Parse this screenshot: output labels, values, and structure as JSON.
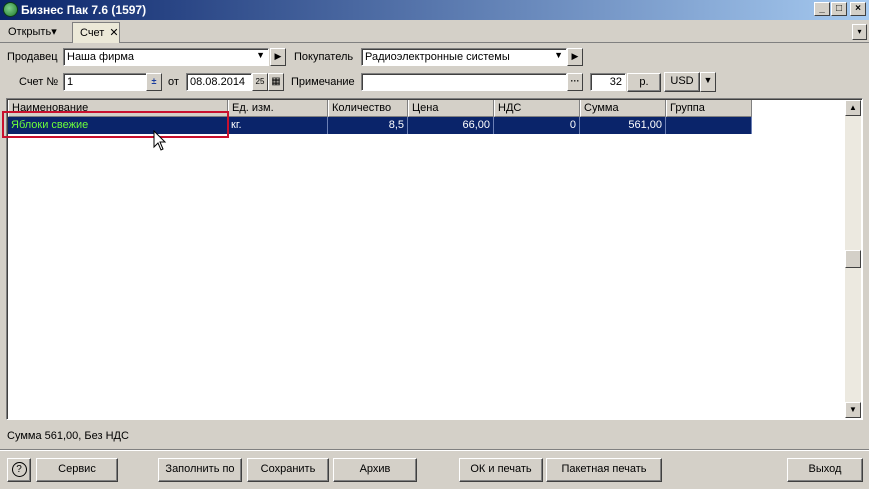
{
  "window": {
    "title": "Бизнес Пак 7.6 (1597)",
    "min": "_",
    "max": "□",
    "close": "×"
  },
  "tabs": {
    "open_label": "Открыть",
    "open_arrow": "▾",
    "active_tab": "Счет",
    "close_icon": "✕",
    "menu_arrow": "▾"
  },
  "form": {
    "seller_label": "Продавец",
    "seller_value": "Наша фирма",
    "buyer_label": "Покупатель",
    "buyer_value": "Радиоэлектронные системы",
    "invoice_label": "Счет №",
    "invoice_value": "1",
    "from_label": "от",
    "date_value": "08.08.2014",
    "note_label": "Примечание",
    "note_value": "",
    "number_value": "32",
    "currency_short": "р.",
    "currency": "USD"
  },
  "table": {
    "columns": [
      "Наименование",
      "Ед. изм.",
      "Количество",
      "Цена",
      "НДС",
      "Сумма",
      "Группа"
    ],
    "rows": [
      {
        "name": "Яблоки свежие",
        "unit": "кг.",
        "qty": "8,5",
        "price": "66,00",
        "vat": "0",
        "sum": "561,00",
        "group": ""
      }
    ]
  },
  "status": "Сумма 561,00, Без НДС",
  "buttons": {
    "help": "?",
    "service": "Сервис",
    "fill": "Заполнить по",
    "save": "Сохранить",
    "archive": "Архив",
    "ok_print": "ОК и печать",
    "batch_print": "Пакетная печать",
    "exit": "Выход"
  }
}
